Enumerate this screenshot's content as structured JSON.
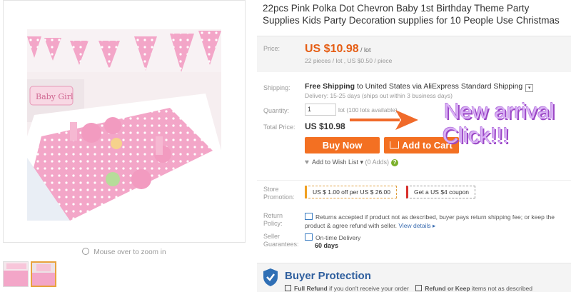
{
  "title": "22pcs Pink Polka Dot Chevron Baby 1st Birthday Theme Party Supplies Kids Party Decoration supplies for 10 People Use Christmas",
  "gallery": {
    "zoom_hint": "Mouse over to zoom in",
    "banner_text": "Baby Girl"
  },
  "price": {
    "label": "Price:",
    "value": "US $10.98",
    "unit": "/ lot",
    "sub": "22 pieces / lot , US $0.50 / piece"
  },
  "shipping": {
    "label": "Shipping:",
    "free": "Free Shipping",
    "to": "to",
    "destination": "United States via AliExpress Standard Shipping",
    "delivery": "Delivery: 15-25 days (ships out within 3 business days)"
  },
  "quantity": {
    "label": "Quantity:",
    "value": "1",
    "note": "lot (100 lots available)"
  },
  "total": {
    "label": "Total Price:",
    "value": "US $10.98"
  },
  "overlay": {
    "line1": "New arrival",
    "line2": "Click!!!",
    "color": "#d9b0f5"
  },
  "buttons": {
    "buy_now": "Buy Now",
    "add_to_cart": "Add to Cart"
  },
  "wishlist": {
    "label": "Add to Wish List",
    "count": "(0 Adds)",
    "help": "?"
  },
  "promotion": {
    "label": "Store Promotion:",
    "coupon1": "US $ 1.00 off per US $ 26.00",
    "coupon2": "Get a US $4 coupon"
  },
  "return_policy": {
    "label": "Return Policy:",
    "text": "Returns accepted if product not as described, buyer pays return shipping fee; or keep the product & agree refund with seller.",
    "link": "View details"
  },
  "guarantee": {
    "label": "Seller Guarantees:",
    "line1": "On-time Delivery",
    "line2": "60 days"
  },
  "buyer_protection": {
    "title": "Buyer Protection",
    "full_refund_bold": "Full Refund",
    "full_refund_rest": "if you don't receive your order",
    "refund_keep_bold": "Refund or Keep",
    "refund_keep_rest": "items not as described"
  },
  "colors": {
    "price_orange": "#e55d14",
    "button_orange": "#f37022",
    "link_blue": "#3a6cb0",
    "protection_blue": "#2f5f9e",
    "arrow_orange": "#f06a2a"
  },
  "icons": [
    "magnifier-icon",
    "dropdown-arrow-icon",
    "cart-icon",
    "heart-icon",
    "help-icon",
    "return-icon",
    "delivery-icon",
    "shield-icon",
    "check-icon"
  ]
}
